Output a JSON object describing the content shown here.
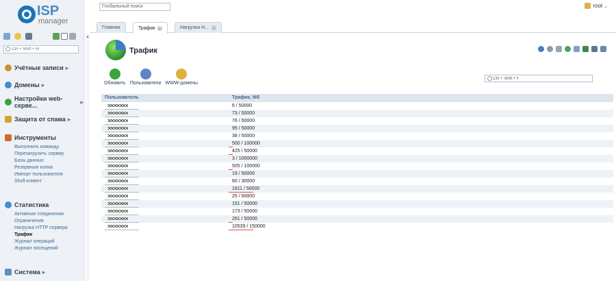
{
  "app": {
    "logo_text": "ISP",
    "logo_sub": "manager"
  },
  "topbar": {
    "global_search_value": "Глобальный поиск",
    "user": "root"
  },
  "sidebar": {
    "search_placeholder": "Ctrl + Shift + M",
    "sections": [
      {
        "label": "Учётные записи",
        "caret": "▸",
        "icon_color": "#c7922e"
      },
      {
        "label": "Домены",
        "caret": "▸",
        "icon_color": "#3a8ed6"
      },
      {
        "label": "Настройки web-серве...",
        "caret": "▸",
        "icon_color": "#3d9f3d"
      },
      {
        "label": "Защита от спама",
        "caret": "▸",
        "icon_color": "#d9a332"
      },
      {
        "label": "Инструменты",
        "caret": "",
        "icon_color": "#d06a2a"
      },
      {
        "label": "Статистика",
        "caret": "",
        "icon_color": "#3c8ed8"
      },
      {
        "label": "Система",
        "caret": "▸",
        "icon_color": "#5f8fbf"
      }
    ],
    "tools_items": [
      "Выполнить команду",
      "Перезагрузить сервер",
      "Базы данных",
      "Резервные копии",
      "Импорт пользователя",
      "Shell-клиент"
    ],
    "stats_items": [
      "Активные соединения",
      "Ограничения",
      "Нагрузка HTTP сервера",
      "Трафик",
      "Журнал операций",
      "Журнал посещений"
    ]
  },
  "tabs": [
    {
      "label": "Главная",
      "closable": false
    },
    {
      "label": "Трафик",
      "closable": true,
      "active": true
    },
    {
      "label": "Нагрузка Н...",
      "closable": true
    }
  ],
  "page": {
    "title": "Трафик"
  },
  "toolbar": [
    {
      "label": "Обновить",
      "icon": "refresh-icon",
      "color": "#3ca43c"
    },
    {
      "label": "Пользователи",
      "icon": "users-icon",
      "color": "#5c86c4"
    },
    {
      "label": "WWW-домены",
      "icon": "www-icon",
      "color": "#e0b13a"
    }
  ],
  "table_search_value": "Ctrl + Shift + F",
  "grid": {
    "columns": [
      "Пользователь",
      "Трафик, Мб"
    ],
    "rows": [
      {
        "traffic": "6 / 50000",
        "warn": ""
      },
      {
        "traffic": "73 / 50000",
        "warn": ""
      },
      {
        "traffic": "76 / 50000",
        "warn": ""
      },
      {
        "traffic": "95 / 50000",
        "warn": ""
      },
      {
        "traffic": "38 / 50000",
        "warn": ""
      },
      {
        "traffic": "500 / 100000",
        "warn": "short"
      },
      {
        "traffic": "425 / 50000",
        "warn": "short"
      },
      {
        "traffic": "3 / 1000000",
        "warn": ""
      },
      {
        "traffic": "505 / 100000",
        "warn": "short"
      },
      {
        "traffic": "19 / 50000",
        "warn": ""
      },
      {
        "traffic": "60 / 30000",
        "warn": ""
      },
      {
        "traffic": "1611 / 50000",
        "warn": "long"
      },
      {
        "traffic": "25 / 50000",
        "warn": ""
      },
      {
        "traffic": "151 / 50000",
        "warn": ""
      },
      {
        "traffic": "173 / 50000",
        "warn": ""
      },
      {
        "traffic": "261 / 50000",
        "warn": "short"
      },
      {
        "traffic": "10539 / 150000",
        "warn": "long"
      }
    ]
  }
}
